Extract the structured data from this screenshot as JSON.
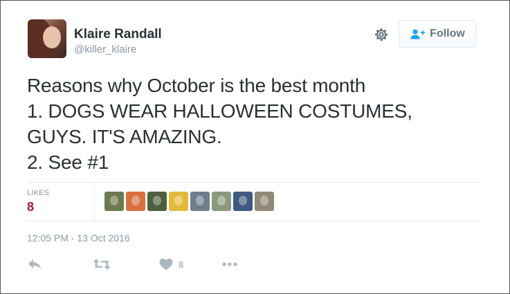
{
  "user": {
    "name": "Klaire Randall",
    "handle": "@killer_klaire"
  },
  "follow_label": "Follow",
  "tweet": {
    "lines": [
      "Reasons why October is the best month",
      "1. DOGS WEAR HALLOWEEN COSTUMES,",
      "GUYS. IT'S AMAZING.",
      "2. See #1"
    ]
  },
  "stats": {
    "likes_label": "LIKES",
    "likes_count": "8",
    "liker_avatar_colors": [
      "#6b7a4e",
      "#d9703f",
      "#4f5f3e",
      "#e3b93a",
      "#6d7f8c",
      "#8a9a7d",
      "#3e5a80",
      "#8f8a78"
    ]
  },
  "timestamp": "12:05 PM - 13 Oct 2016",
  "actions": {
    "reply_icon": "reply-icon",
    "retweet_icon": "retweet-icon",
    "like_icon": "heart-icon",
    "like_count": "8",
    "more_icon": "more-icon"
  },
  "colors": {
    "likes_count": "#9b1946",
    "muted": "#8899a6",
    "action_icons": "#aab8c2"
  }
}
